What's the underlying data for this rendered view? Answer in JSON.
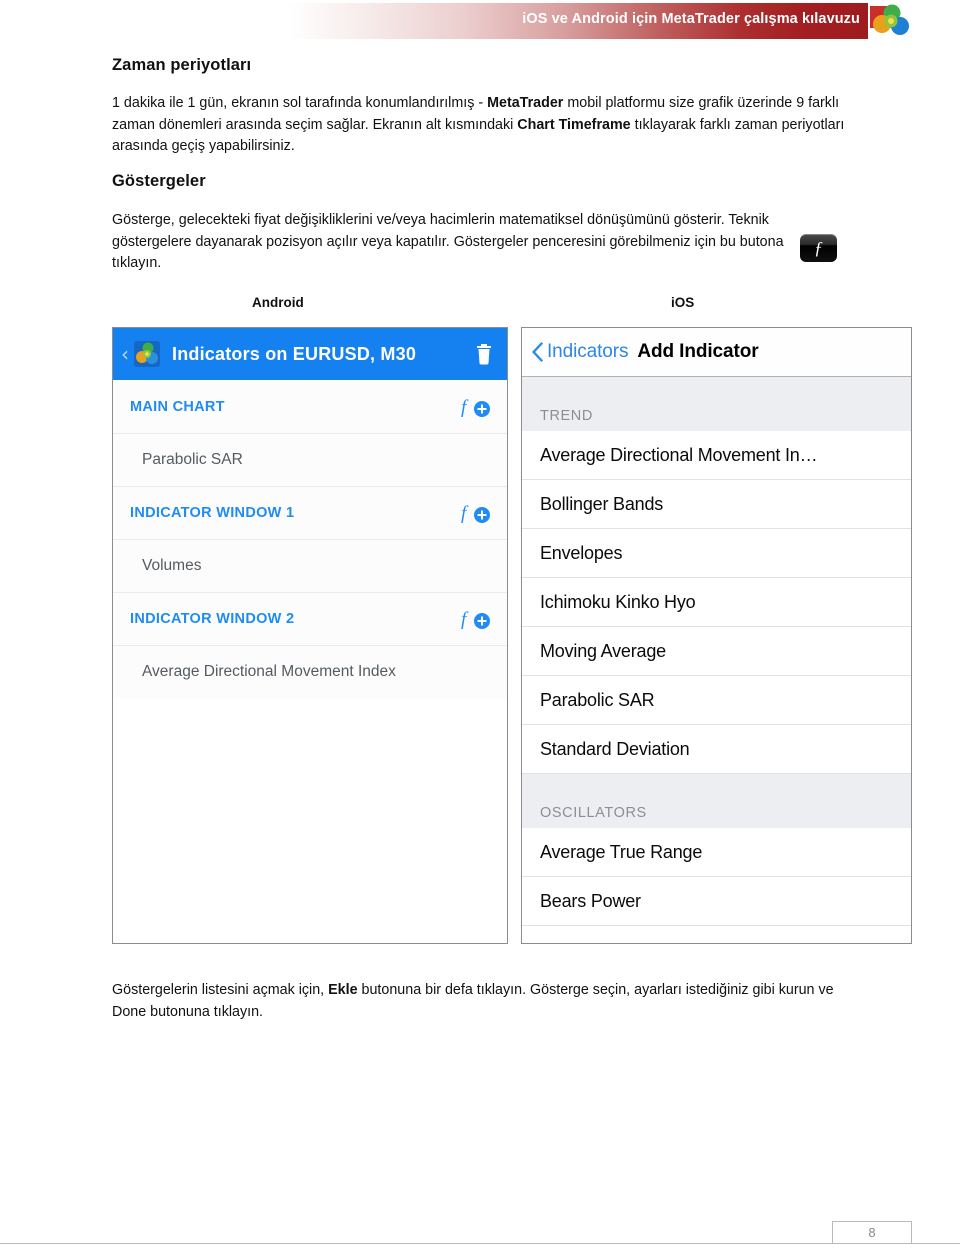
{
  "banner": {
    "title": "iOS ve Android için MetaTrader çalışma kılavuzu",
    "logo_icon": "metatrader-logo-icon",
    "accent_color": "#9e1b1e"
  },
  "sections": {
    "timeframes": {
      "heading": "Zaman periyotları",
      "paragraph_html": "1 dakika ile 1 gün, ekranın sol tarafında konumlandırılmış - <b>MetaTrader</b> mobil platformu size grafik üzerinde 9 farklı zaman dönemleri arasında seçim sağlar. Ekranın alt kısmındaki <b>Chart Timeframe</b> tıklayarak farklı zaman periyotları arasında geçiş yapabilirsiniz."
    },
    "indicators": {
      "heading": "Göstergeler",
      "paragraph_html": "Gösterge, gelecekteki fiyat değişikliklerini ve/veya hacimlerin matematiksel dönüşümünü gösterir. Teknik göstergelere dayanarak pozisyon açılır veya kapatılır. Göstergeler penceresini görebilmeniz için bu butona tıklayın.",
      "fx_button_glyph": "ƒ",
      "fx_button_icon": "fx-indicator-button-icon"
    },
    "bottom": {
      "paragraph_html": "Göstergelerin listesini açmak için, <b>Ekle</b> butonuna bir defa tıklayın. Gösterge seçin, ayarları istediğiniz gibi kurun ve Done butonuna tıklayın."
    }
  },
  "platform_labels": {
    "android": "Android",
    "ios": "iOS"
  },
  "android_screenshot": {
    "appbar": {
      "back_glyph": "‹",
      "logo_icon": "metatrader-logo-icon",
      "title": "Indicators on EURUSD, M30",
      "trash_icon": "trash-icon",
      "bar_color": "#1580f0"
    },
    "groups": [
      {
        "label": "MAIN CHART",
        "add_icon": "fx-add-icon",
        "items": [
          "Parabolic SAR"
        ]
      },
      {
        "label": "INDICATOR WINDOW 1",
        "add_icon": "fx-add-icon",
        "items": [
          "Volumes"
        ]
      },
      {
        "label": "INDICATOR WINDOW 2",
        "add_icon": "fx-add-icon",
        "items": [
          "Average Directional Movement Index"
        ]
      }
    ]
  },
  "ios_screenshot": {
    "navbar": {
      "back_icon": "chevron-left-icon",
      "back_label": "Indicators",
      "title": "Add Indicator",
      "tint_color": "#2d87e8"
    },
    "sections": [
      {
        "header": "TREND",
        "rows": [
          "Average Directional Movement In…",
          "Bollinger Bands",
          "Envelopes",
          "Ichimoku Kinko Hyo",
          "Moving Average",
          "Parabolic SAR",
          "Standard Deviation"
        ]
      },
      {
        "header": "OSCILLATORS",
        "rows": [
          "Average True Range",
          "Bears Power"
        ]
      }
    ]
  },
  "footer": {
    "page_number": "8"
  }
}
